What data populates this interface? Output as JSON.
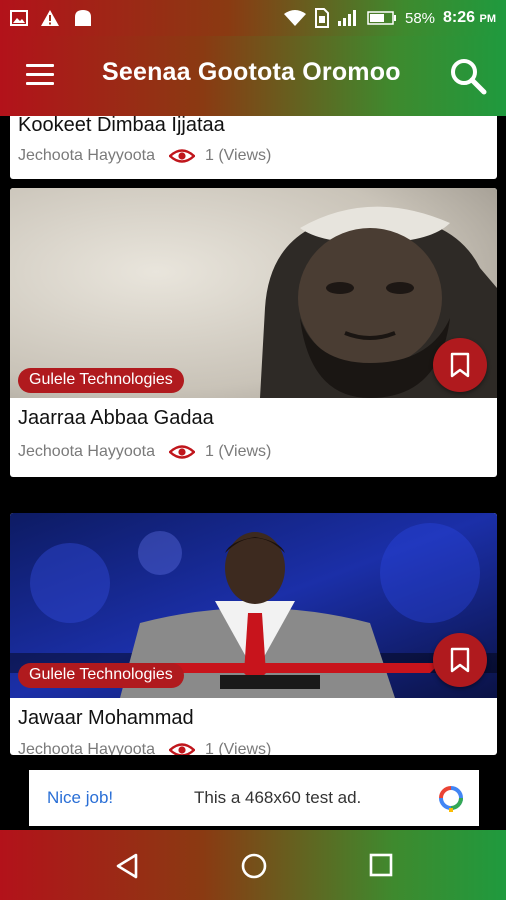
{
  "statusbar": {
    "battery": "58%",
    "time": "8:26",
    "ampm": "PM",
    "icons": [
      "image-icon",
      "warning-icon",
      "notification-icon",
      "wifi-icon",
      "sim-icon",
      "signal-icon",
      "battery-icon"
    ]
  },
  "appbar": {
    "title": "Seenaa Gootota Oromoo",
    "menu_icon": "hamburger-icon",
    "search_icon": "search-icon"
  },
  "feed": {
    "items": [
      {
        "title": "Kookeet Dimbaa Ijjataa",
        "category": "Jechoota Hayyoota",
        "views": "1 (Views)"
      },
      {
        "tag": "Gulele Technologies",
        "title": "Jaarraa Abbaa Gadaa",
        "category": "Jechoota Hayyoota",
        "views": "1 (Views)",
        "image": "portrait-elder"
      },
      {
        "tag": "Gulele Technologies",
        "title": "Jawaar Mohammad",
        "category": "Jechoota Hayyoota",
        "views": "1 (Views)",
        "image": "tv-studio-portrait"
      }
    ]
  },
  "ad": {
    "nice": "Nice job!",
    "text": "This a 468x60 test ad."
  },
  "navbar": {
    "icons": [
      "back-icon",
      "home-icon",
      "recents-icon"
    ]
  },
  "colors": {
    "brand_red": "#b01a1e",
    "brand_green": "#1f9a3e"
  }
}
